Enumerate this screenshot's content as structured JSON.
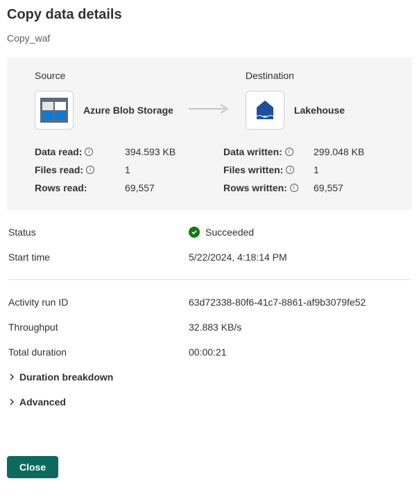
{
  "title": "Copy data details",
  "activity_name": "Copy_waf",
  "source": {
    "heading": "Source",
    "label": "Azure Blob Storage",
    "stats": {
      "data_read_label": "Data read:",
      "data_read_value": "394.593 KB",
      "files_read_label": "Files read:",
      "files_read_value": "1",
      "rows_read_label": "Rows read:",
      "rows_read_value": "69,557"
    }
  },
  "destination": {
    "heading": "Destination",
    "label": "Lakehouse",
    "stats": {
      "data_written_label": "Data written:",
      "data_written_value": "299.048 KB",
      "files_written_label": "Files written:",
      "files_written_value": "1",
      "rows_written_label": "Rows written:",
      "rows_written_value": "69,557"
    }
  },
  "details": {
    "status_label": "Status",
    "status_value": "Succeeded",
    "start_time_label": "Start time",
    "start_time_value": "5/22/2024, 4:18:14 PM",
    "run_id_label": "Activity run ID",
    "run_id_value": "63d72338-80f6-41c7-8861-af9b3079fe52",
    "throughput_label": "Throughput",
    "throughput_value": "32.883 KB/s",
    "duration_label": "Total duration",
    "duration_value": "00:00:21"
  },
  "expanders": {
    "duration_breakdown": "Duration breakdown",
    "advanced": "Advanced"
  },
  "buttons": {
    "close": "Close"
  }
}
